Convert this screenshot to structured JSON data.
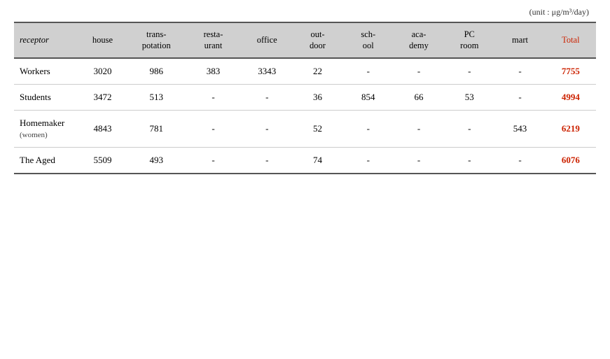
{
  "unit_label": "(unit : μg/m³/day)",
  "headers": {
    "receptor": "receptor",
    "house": "house",
    "transportation": [
      "trans-",
      "potation"
    ],
    "restaurant": [
      "resta-",
      "urant"
    ],
    "office": "office",
    "outdoor": [
      "out-",
      "door"
    ],
    "school": [
      "sch-",
      "ool"
    ],
    "academy": [
      "aca-",
      "demy"
    ],
    "pcroom": [
      "PC",
      "room"
    ],
    "mart": "mart",
    "total": "Total"
  },
  "rows": [
    {
      "receptor": "Workers",
      "house": "3020",
      "transportation": "986",
      "restaurant": "383",
      "office": "3343",
      "outdoor": "22",
      "school": "-",
      "academy": "-",
      "pcroom": "-",
      "mart": "-",
      "total": "7755"
    },
    {
      "receptor": "Students",
      "house": "3472",
      "transportation": "513",
      "restaurant": "-",
      "office": "-",
      "outdoor": "36",
      "school": "854",
      "academy": "66",
      "pcroom": "53",
      "mart": "-",
      "total": "4994"
    },
    {
      "receptor": "Homemaker",
      "receptor_sub": "(women)",
      "house": "4843",
      "transportation": "781",
      "restaurant": "-",
      "office": "-",
      "outdoor": "52",
      "school": "-",
      "academy": "-",
      "pcroom": "-",
      "mart": "543",
      "total": "6219"
    },
    {
      "receptor": "The Aged",
      "house": "5509",
      "transportation": "493",
      "restaurant": "-",
      "office": "-",
      "outdoor": "74",
      "school": "-",
      "academy": "-",
      "pcroom": "-",
      "mart": "-",
      "total": "6076"
    }
  ]
}
